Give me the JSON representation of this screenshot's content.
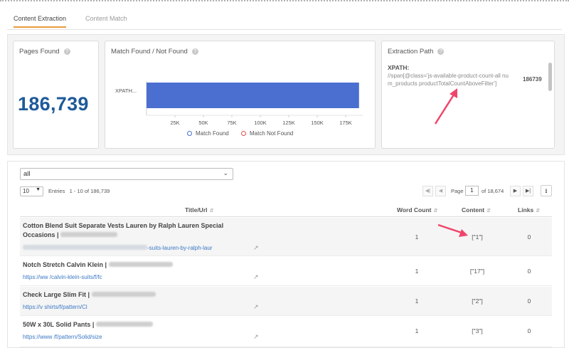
{
  "tabs": [
    {
      "label": "Content Extraction",
      "active": true
    },
    {
      "label": "Content Match",
      "active": false
    }
  ],
  "cards": {
    "pages_found": {
      "title": "Pages Found",
      "value": "186,739"
    },
    "match": {
      "title": "Match Found / Not Found",
      "legend": [
        "Match Found",
        "Match Not Found"
      ]
    },
    "extraction": {
      "title": "Extraction Path",
      "xpath_label": "XPATH:",
      "xpath_text": "//span[@class='js-available-product-count-all num_products productTotalCountAboveFilter']",
      "count": "186739"
    }
  },
  "chart_data": {
    "type": "bar",
    "orientation": "horizontal",
    "categories": [
      "XPATH..."
    ],
    "series": [
      {
        "name": "Match Found",
        "values": [
          186739
        ],
        "color": "#4a6fd0"
      },
      {
        "name": "Match Not Found",
        "values": [
          0
        ],
        "color": "#e05050"
      }
    ],
    "xticks": [
      "25K",
      "50K",
      "75K",
      "100K",
      "125K",
      "150K",
      "175K"
    ],
    "xlim": [
      0,
      190000
    ],
    "legend_position": "bottom"
  },
  "filter": {
    "selected": "all"
  },
  "paging": {
    "page_size": "10",
    "entries_label": "Entries",
    "entries_range": "1 - 10 of 186,739",
    "page_label": "Page",
    "page_value": "1",
    "page_total": "of 18,674"
  },
  "table": {
    "headers": {
      "title_url": "Title/Url",
      "word_count": "Word Count",
      "content": "Content",
      "links": "Links"
    },
    "rows": [
      {
        "title": "Cotton Blend Suit Separate Vests Lauren by Ralph Lauren Special Occasions |",
        "url": "-suits-lauren-by-ralph-laur",
        "word_count": "1",
        "content": "[\"1\"]",
        "links": "0"
      },
      {
        "title": "Notch Stretch Calvin Klein |",
        "url": "https://ww /calvin-klein-suits/f/fc",
        "word_count": "1",
        "content": "[\"17\"]",
        "links": "0"
      },
      {
        "title": "Check Large Slim Fit |",
        "url": "https://v shirts/f/pattern/Cl",
        "word_count": "1",
        "content": "[\"2\"]",
        "links": "0"
      },
      {
        "title": "50W x 30L Solid Pants |",
        "url": "https://www /f/pattern/Solid/size",
        "word_count": "1",
        "content": "[\"3\"]",
        "links": "0"
      }
    ]
  },
  "colors": {
    "accent": "#e89a3c",
    "number": "#1e5a99",
    "bar": "#4a6fd0",
    "link": "#3b78c4",
    "annotation_arrow": "#f0456a"
  }
}
